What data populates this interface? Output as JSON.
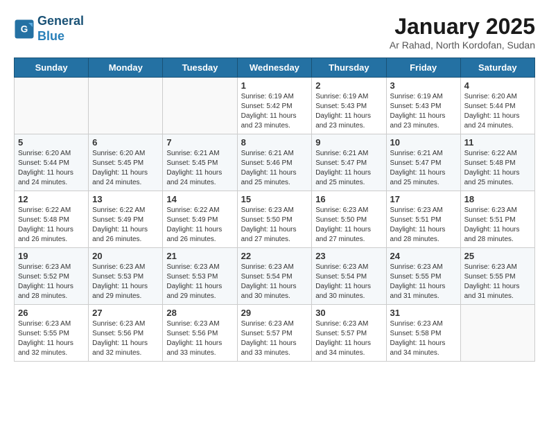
{
  "logo": {
    "line1": "General",
    "line2": "Blue"
  },
  "title": "January 2025",
  "subtitle": "Ar Rahad, North Kordofan, Sudan",
  "days_of_week": [
    "Sunday",
    "Monday",
    "Tuesday",
    "Wednesday",
    "Thursday",
    "Friday",
    "Saturday"
  ],
  "weeks": [
    [
      {
        "day": "",
        "sunrise": "",
        "sunset": "",
        "daylight": ""
      },
      {
        "day": "",
        "sunrise": "",
        "sunset": "",
        "daylight": ""
      },
      {
        "day": "",
        "sunrise": "",
        "sunset": "",
        "daylight": ""
      },
      {
        "day": "1",
        "sunrise": "Sunrise: 6:19 AM",
        "sunset": "Sunset: 5:42 PM",
        "daylight": "Daylight: 11 hours and 23 minutes."
      },
      {
        "day": "2",
        "sunrise": "Sunrise: 6:19 AM",
        "sunset": "Sunset: 5:43 PM",
        "daylight": "Daylight: 11 hours and 23 minutes."
      },
      {
        "day": "3",
        "sunrise": "Sunrise: 6:19 AM",
        "sunset": "Sunset: 5:43 PM",
        "daylight": "Daylight: 11 hours and 23 minutes."
      },
      {
        "day": "4",
        "sunrise": "Sunrise: 6:20 AM",
        "sunset": "Sunset: 5:44 PM",
        "daylight": "Daylight: 11 hours and 24 minutes."
      }
    ],
    [
      {
        "day": "5",
        "sunrise": "Sunrise: 6:20 AM",
        "sunset": "Sunset: 5:44 PM",
        "daylight": "Daylight: 11 hours and 24 minutes."
      },
      {
        "day": "6",
        "sunrise": "Sunrise: 6:20 AM",
        "sunset": "Sunset: 5:45 PM",
        "daylight": "Daylight: 11 hours and 24 minutes."
      },
      {
        "day": "7",
        "sunrise": "Sunrise: 6:21 AM",
        "sunset": "Sunset: 5:45 PM",
        "daylight": "Daylight: 11 hours and 24 minutes."
      },
      {
        "day": "8",
        "sunrise": "Sunrise: 6:21 AM",
        "sunset": "Sunset: 5:46 PM",
        "daylight": "Daylight: 11 hours and 25 minutes."
      },
      {
        "day": "9",
        "sunrise": "Sunrise: 6:21 AM",
        "sunset": "Sunset: 5:47 PM",
        "daylight": "Daylight: 11 hours and 25 minutes."
      },
      {
        "day": "10",
        "sunrise": "Sunrise: 6:21 AM",
        "sunset": "Sunset: 5:47 PM",
        "daylight": "Daylight: 11 hours and 25 minutes."
      },
      {
        "day": "11",
        "sunrise": "Sunrise: 6:22 AM",
        "sunset": "Sunset: 5:48 PM",
        "daylight": "Daylight: 11 hours and 25 minutes."
      }
    ],
    [
      {
        "day": "12",
        "sunrise": "Sunrise: 6:22 AM",
        "sunset": "Sunset: 5:48 PM",
        "daylight": "Daylight: 11 hours and 26 minutes."
      },
      {
        "day": "13",
        "sunrise": "Sunrise: 6:22 AM",
        "sunset": "Sunset: 5:49 PM",
        "daylight": "Daylight: 11 hours and 26 minutes."
      },
      {
        "day": "14",
        "sunrise": "Sunrise: 6:22 AM",
        "sunset": "Sunset: 5:49 PM",
        "daylight": "Daylight: 11 hours and 26 minutes."
      },
      {
        "day": "15",
        "sunrise": "Sunrise: 6:23 AM",
        "sunset": "Sunset: 5:50 PM",
        "daylight": "Daylight: 11 hours and 27 minutes."
      },
      {
        "day": "16",
        "sunrise": "Sunrise: 6:23 AM",
        "sunset": "Sunset: 5:50 PM",
        "daylight": "Daylight: 11 hours and 27 minutes."
      },
      {
        "day": "17",
        "sunrise": "Sunrise: 6:23 AM",
        "sunset": "Sunset: 5:51 PM",
        "daylight": "Daylight: 11 hours and 28 minutes."
      },
      {
        "day": "18",
        "sunrise": "Sunrise: 6:23 AM",
        "sunset": "Sunset: 5:51 PM",
        "daylight": "Daylight: 11 hours and 28 minutes."
      }
    ],
    [
      {
        "day": "19",
        "sunrise": "Sunrise: 6:23 AM",
        "sunset": "Sunset: 5:52 PM",
        "daylight": "Daylight: 11 hours and 28 minutes."
      },
      {
        "day": "20",
        "sunrise": "Sunrise: 6:23 AM",
        "sunset": "Sunset: 5:53 PM",
        "daylight": "Daylight: 11 hours and 29 minutes."
      },
      {
        "day": "21",
        "sunrise": "Sunrise: 6:23 AM",
        "sunset": "Sunset: 5:53 PM",
        "daylight": "Daylight: 11 hours and 29 minutes."
      },
      {
        "day": "22",
        "sunrise": "Sunrise: 6:23 AM",
        "sunset": "Sunset: 5:54 PM",
        "daylight": "Daylight: 11 hours and 30 minutes."
      },
      {
        "day": "23",
        "sunrise": "Sunrise: 6:23 AM",
        "sunset": "Sunset: 5:54 PM",
        "daylight": "Daylight: 11 hours and 30 minutes."
      },
      {
        "day": "24",
        "sunrise": "Sunrise: 6:23 AM",
        "sunset": "Sunset: 5:55 PM",
        "daylight": "Daylight: 11 hours and 31 minutes."
      },
      {
        "day": "25",
        "sunrise": "Sunrise: 6:23 AM",
        "sunset": "Sunset: 5:55 PM",
        "daylight": "Daylight: 11 hours and 31 minutes."
      }
    ],
    [
      {
        "day": "26",
        "sunrise": "Sunrise: 6:23 AM",
        "sunset": "Sunset: 5:55 PM",
        "daylight": "Daylight: 11 hours and 32 minutes."
      },
      {
        "day": "27",
        "sunrise": "Sunrise: 6:23 AM",
        "sunset": "Sunset: 5:56 PM",
        "daylight": "Daylight: 11 hours and 32 minutes."
      },
      {
        "day": "28",
        "sunrise": "Sunrise: 6:23 AM",
        "sunset": "Sunset: 5:56 PM",
        "daylight": "Daylight: 11 hours and 33 minutes."
      },
      {
        "day": "29",
        "sunrise": "Sunrise: 6:23 AM",
        "sunset": "Sunset: 5:57 PM",
        "daylight": "Daylight: 11 hours and 33 minutes."
      },
      {
        "day": "30",
        "sunrise": "Sunrise: 6:23 AM",
        "sunset": "Sunset: 5:57 PM",
        "daylight": "Daylight: 11 hours and 34 minutes."
      },
      {
        "day": "31",
        "sunrise": "Sunrise: 6:23 AM",
        "sunset": "Sunset: 5:58 PM",
        "daylight": "Daylight: 11 hours and 34 minutes."
      },
      {
        "day": "",
        "sunrise": "",
        "sunset": "",
        "daylight": ""
      }
    ]
  ]
}
